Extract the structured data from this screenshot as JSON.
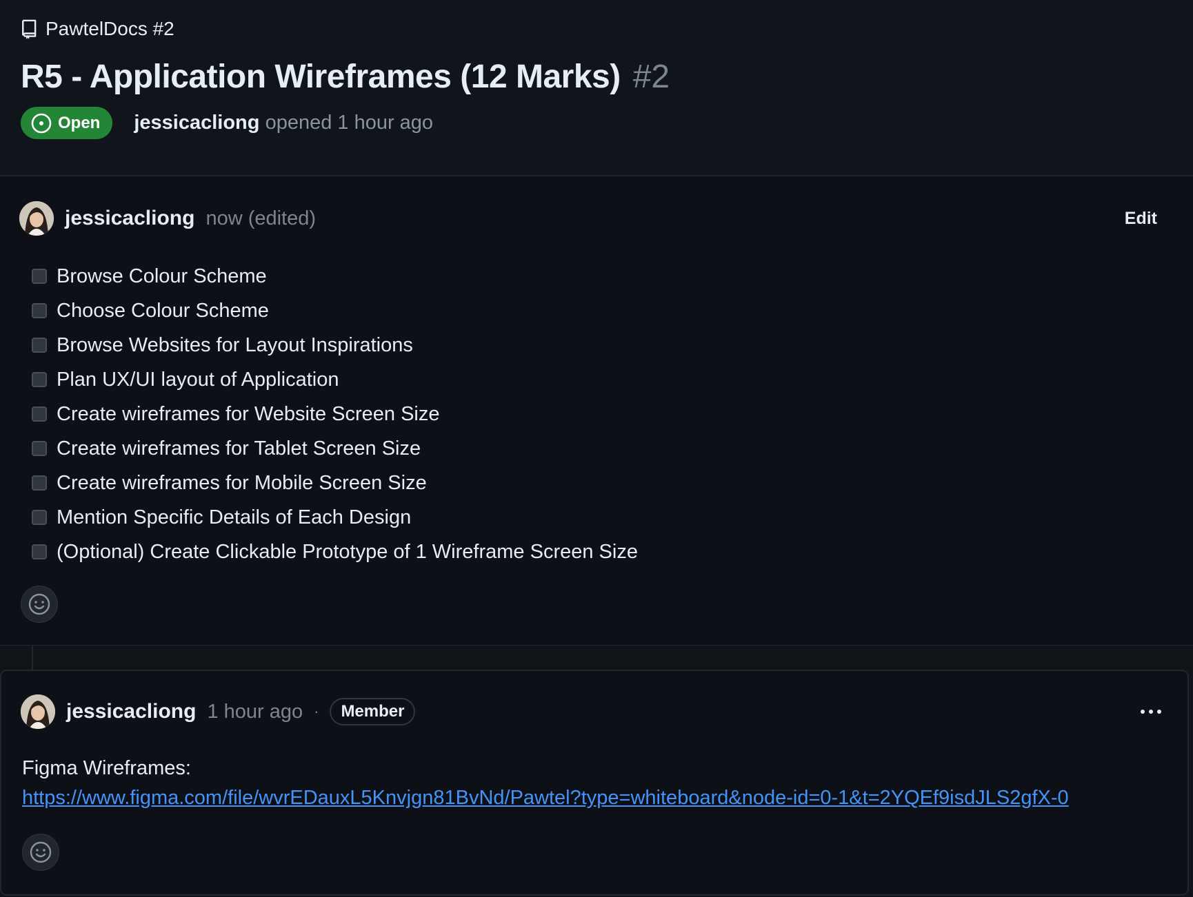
{
  "repo": {
    "name": "PawtelDocs #2",
    "icon": "repo-icon"
  },
  "issue": {
    "title": "R5 - Application Wireframes (12 Marks)",
    "number": "#2",
    "state": "Open",
    "author": "jessicacliong",
    "opened_text": "opened 1 hour ago"
  },
  "comment1": {
    "author": "jessicacliong",
    "time": "now (edited)",
    "edit_label": "Edit",
    "tasks": [
      "Browse Colour Scheme",
      "Choose Colour Scheme",
      "Browse Websites for Layout Inspirations",
      "Plan UX/UI layout of Application",
      "Create wireframes for Website Screen Size",
      "Create wireframes for Tablet Screen Size",
      "Create wireframes for Mobile Screen Size",
      "Mention Specific Details of Each Design",
      "(Optional) Create Clickable Prototype of 1 Wireframe Screen Size"
    ]
  },
  "comment2": {
    "author": "jessicacliong",
    "time": "1 hour ago",
    "separator": "·",
    "badge": "Member",
    "text": "Figma Wireframes:",
    "link": "https://www.figma.com/file/wvrEDauxL5Knvjgn81BvNd/Pawtel?type=whiteboard&node-id=0-1&t=2YQEf9isdJLS2gfX-0"
  },
  "colors": {
    "background": "#10141b",
    "open_badge": "#238636",
    "link": "#4493f8",
    "muted_text": "#7d8590"
  }
}
